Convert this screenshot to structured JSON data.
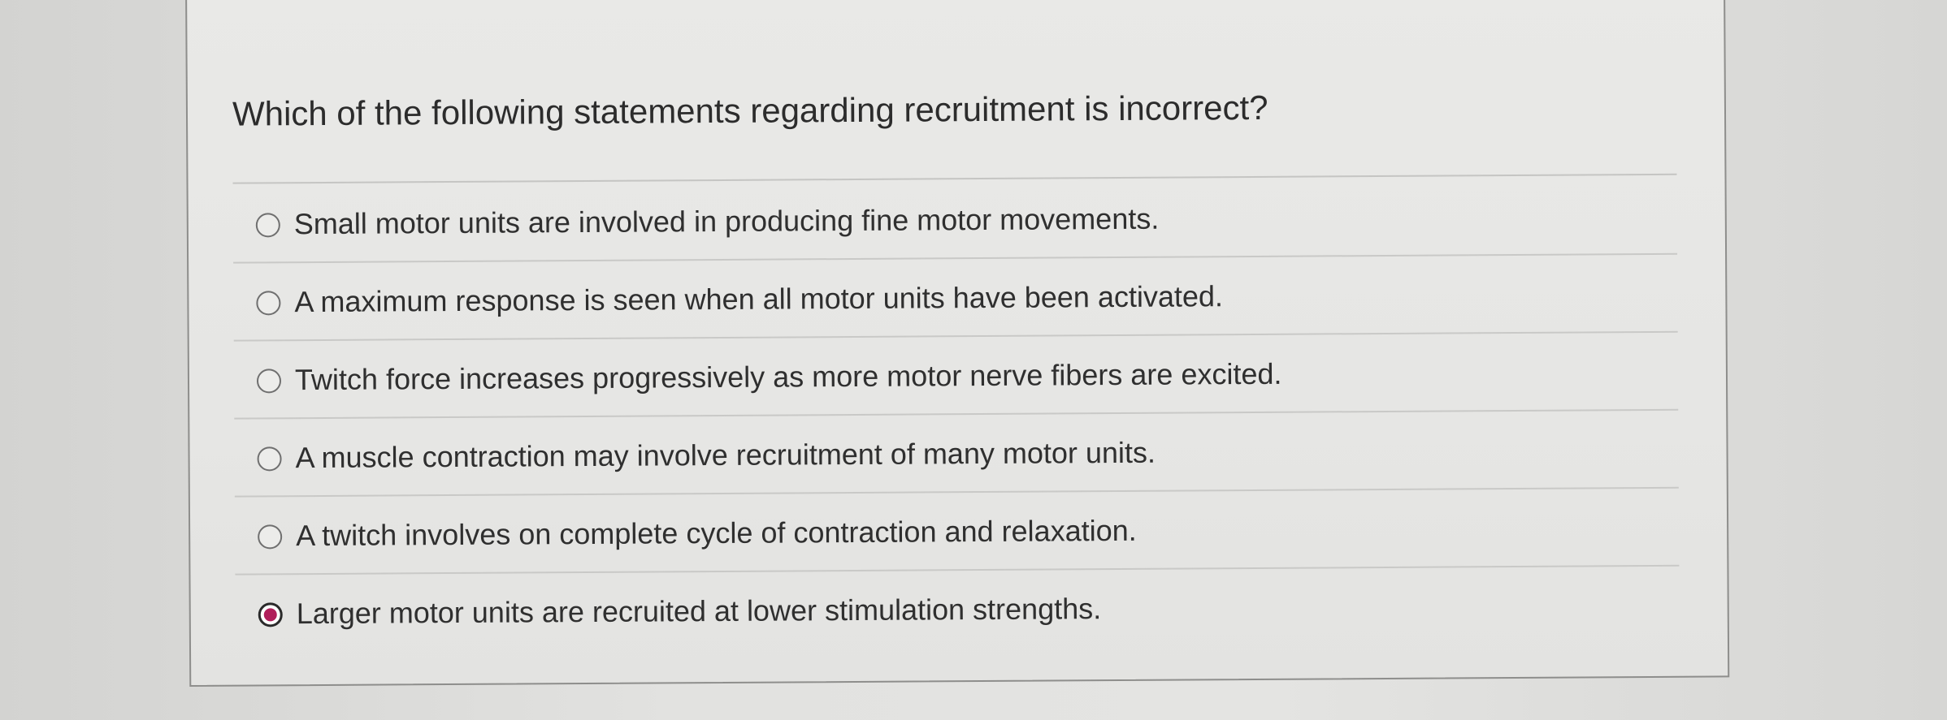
{
  "question": {
    "text": "Which of the following statements regarding recruitment is incorrect?"
  },
  "options": [
    {
      "label": "Small motor units are involved in producing fine motor movements.",
      "selected": false
    },
    {
      "label": "A maximum response is seen when all motor units have been activated.",
      "selected": false
    },
    {
      "label": "Twitch force increases progressively as more motor nerve fibers are excited.",
      "selected": false
    },
    {
      "label": "A muscle contraction may involve recruitment of many motor units.",
      "selected": false
    },
    {
      "label": "A twitch involves on complete cycle of contraction and relaxation.",
      "selected": false
    },
    {
      "label": "Larger motor units are recruited at lower stimulation strengths.",
      "selected": true
    }
  ],
  "colors": {
    "selected_radio": "#b01e5a",
    "panel_background": "#e8e8e6",
    "text": "#2f2f2f"
  }
}
